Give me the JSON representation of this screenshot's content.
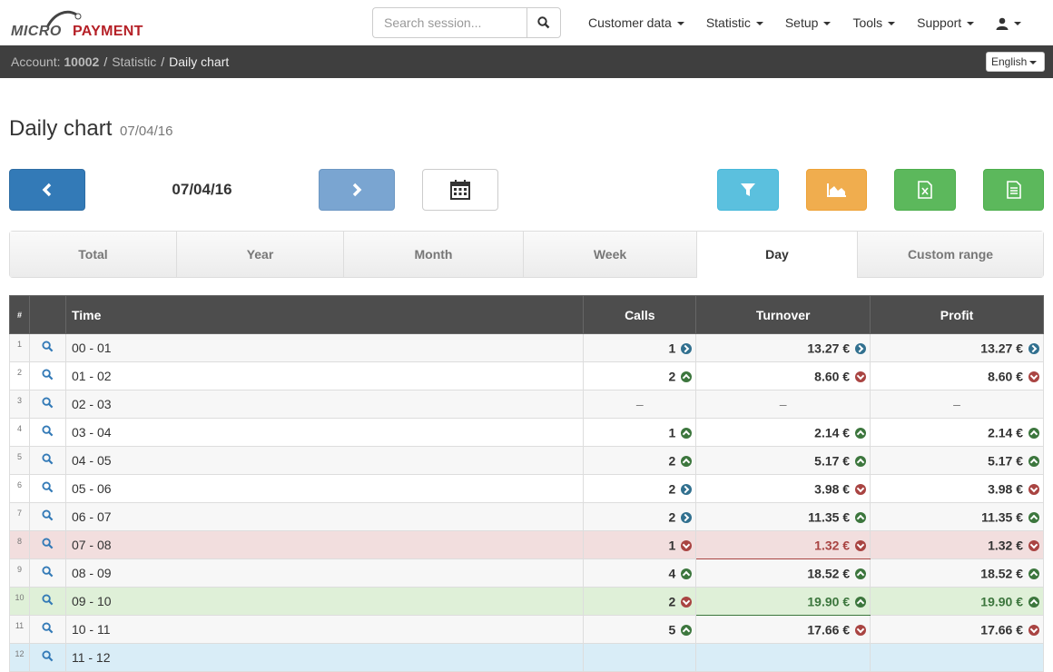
{
  "brand": {
    "part1": "MICRO",
    "part2": "PAYMENT"
  },
  "search": {
    "placeholder": "Search session..."
  },
  "nav": [
    "Customer data",
    "Statistic",
    "Setup",
    "Tools",
    "Support"
  ],
  "breadcrumb": {
    "account_label": "Account:",
    "account_id": "10002",
    "section": "Statistic",
    "current": "Daily chart"
  },
  "language": "English",
  "page": {
    "title": "Daily chart",
    "date": "07/04/16"
  },
  "toolbar": {
    "current_date": "07/04/16"
  },
  "colors": {
    "primary": "#337ab7",
    "info": "#5bc0de",
    "warning": "#f0ad4e",
    "success": "#5cb85c"
  },
  "tabs": [
    "Total",
    "Year",
    "Month",
    "Week",
    "Day",
    "Custom range"
  ],
  "active_tab": "Day",
  "table": {
    "headers": {
      "idx": "#",
      "time": "Time",
      "calls": "Calls",
      "turnover": "Turnover",
      "profit": "Profit"
    },
    "empty": "–",
    "rows": [
      {
        "n": "1",
        "time": "00 - 01",
        "calls": "1",
        "calls_trend": "right",
        "turnover": "13.27 €",
        "turnover_trend": "right",
        "profit": "13.27 €",
        "profit_trend": "right",
        "style": "odd"
      },
      {
        "n": "2",
        "time": "01 - 02",
        "calls": "2",
        "calls_trend": "up",
        "turnover": "8.60 €",
        "turnover_trend": "down",
        "profit": "8.60 €",
        "profit_trend": "down",
        "style": "even"
      },
      {
        "n": "3",
        "time": "02 - 03",
        "calls": "",
        "style": "odd"
      },
      {
        "n": "4",
        "time": "03 - 04",
        "calls": "1",
        "calls_trend": "up",
        "turnover": "2.14 €",
        "turnover_trend": "up",
        "profit": "2.14 €",
        "profit_trend": "up",
        "style": "even"
      },
      {
        "n": "5",
        "time": "04 - 05",
        "calls": "2",
        "calls_trend": "up",
        "turnover": "5.17 €",
        "turnover_trend": "up",
        "profit": "5.17 €",
        "profit_trend": "up",
        "style": "odd"
      },
      {
        "n": "6",
        "time": "05 - 06",
        "calls": "2",
        "calls_trend": "right",
        "turnover": "3.98 €",
        "turnover_trend": "down",
        "profit": "3.98 €",
        "profit_trend": "down",
        "style": "even"
      },
      {
        "n": "7",
        "time": "06 - 07",
        "calls": "2",
        "calls_trend": "right",
        "turnover": "11.35 €",
        "turnover_trend": "up",
        "profit": "11.35 €",
        "profit_trend": "up",
        "style": "odd"
      },
      {
        "n": "8",
        "time": "07 - 08",
        "calls": "1",
        "calls_trend": "down",
        "turnover": "1.32 €",
        "turnover_trend": "down",
        "profit": "1.32 €",
        "profit_trend": "down",
        "style": "danger"
      },
      {
        "n": "9",
        "time": "08 - 09",
        "calls": "4",
        "calls_trend": "up",
        "turnover": "18.52 €",
        "turnover_trend": "up",
        "profit": "18.52 €",
        "profit_trend": "up",
        "style": "odd"
      },
      {
        "n": "10",
        "time": "09 - 10",
        "calls": "2",
        "calls_trend": "down",
        "turnover": "19.90 €",
        "turnover_trend": "up",
        "profit": "19.90 €",
        "profit_trend": "up",
        "style": "success"
      },
      {
        "n": "11",
        "time": "10 - 11",
        "calls": "5",
        "calls_trend": "up",
        "turnover": "17.66 €",
        "turnover_trend": "down",
        "profit": "17.66 €",
        "profit_trend": "down",
        "style": "odd"
      },
      {
        "n": "12",
        "time": "11 - 12",
        "calls": "",
        "style": "info"
      }
    ]
  }
}
